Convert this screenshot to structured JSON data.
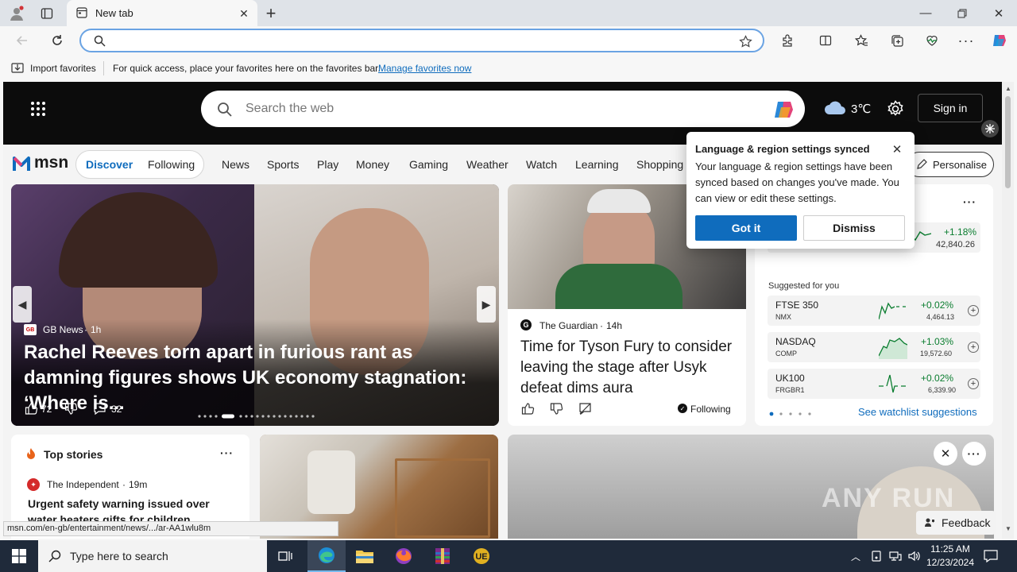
{
  "browser": {
    "tab_title": "New tab",
    "address_placeholder": "",
    "favorites_import": "Import favorites",
    "favorites_hint": "For quick access, place your favorites here on the favorites bar.",
    "favorites_link": "Manage favorites now"
  },
  "msn": {
    "search_placeholder": "Search the web",
    "weather_temp": "3℃",
    "signin": "Sign in",
    "logo_text": "msn",
    "tabs": [
      "Discover",
      "Following"
    ],
    "nav": [
      "News",
      "Sports",
      "Play",
      "Money",
      "Gaming",
      "Weather",
      "Watch",
      "Learning",
      "Shopping"
    ],
    "personalise": "Personalise"
  },
  "hero_story": {
    "source": "GB News",
    "age": "1h",
    "headline": "Rachel Reeves torn apart in furious rant as damning figures shows UK economy stagnation: ‘Where is...",
    "likes": "72",
    "comments": "32"
  },
  "side_story": {
    "source": "The Guardian",
    "age": "14h",
    "headline": "Time for Tyson Fury to consider leaving the stage after Usyk defeat dims aura",
    "following": "Following"
  },
  "watchlist": {
    "top_row": {
      "change": "+1.18%",
      "value": "42,840.26"
    },
    "suggested_label": "Suggested for you",
    "rows": [
      {
        "name": "FTSE 350",
        "code": "NMX",
        "change": "+0.02%",
        "value": "4,464.13"
      },
      {
        "name": "NASDAQ",
        "code": "COMP",
        "change": "+1.03%",
        "value": "19,572.60"
      },
      {
        "name": "UK100",
        "code": "FRGBR1",
        "change": "+0.02%",
        "value": "6,339.90"
      }
    ],
    "see_more": "See watchlist suggestions"
  },
  "top_stories": {
    "heading": "Top stories",
    "source": "The Independent",
    "age": "19m",
    "headline": "Urgent safety warning issued over water heaters gifts for children"
  },
  "popup": {
    "title": "Language & region settings synced",
    "body": "Your language & region settings have been synced based on changes you've made. You can view or edit these settings.",
    "primary": "Got it",
    "secondary": "Dismiss"
  },
  "feedback": "Feedback",
  "watermark": "ANY RUN",
  "status_url": "msn.com/en-gb/entertainment/news/.../ar-AA1wlu8m",
  "taskbar": {
    "search_placeholder": "Type here to search",
    "time": "11:25 AM",
    "date": "12/23/2024"
  },
  "colors": {
    "accent": "#0f6cbd",
    "primary_button": "#0f6cbd",
    "positive": "#0a7d2f"
  }
}
